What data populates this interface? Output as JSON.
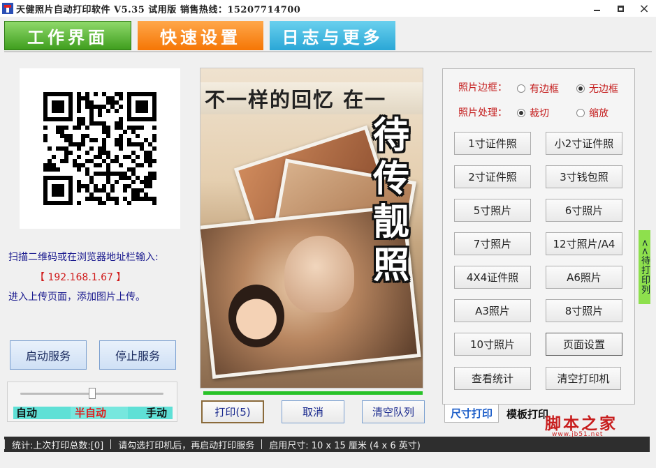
{
  "window": {
    "title": "天健照片自动打印软件  V5.35  试用版 销售热线：15207714700",
    "minimize": "",
    "maximize": "",
    "close": "×"
  },
  "tabs": [
    {
      "label": "工作界面",
      "active": true
    },
    {
      "label": "快速设置",
      "active": false
    },
    {
      "label": "日志与更多",
      "active": false
    }
  ],
  "left": {
    "scan_text": "扫描二维码或在浏览器地址栏输入:",
    "ip": "【 192.168.1.67 】",
    "upload_text": "进入上传页面，添加图片上传。",
    "start_service": "启动服务",
    "stop_service": "停止服务",
    "modes": {
      "auto": "自动",
      "semi_auto": "半自动",
      "manual": "手动",
      "selected": "半自动"
    }
  },
  "preview": {
    "banner": "不一样的回忆  在一",
    "vertical_chars": [
      "待",
      "传",
      "靓",
      "照"
    ]
  },
  "center_buttons": {
    "print": "打印(5)",
    "cancel": "取消",
    "clear_queue": "清空队列"
  },
  "right": {
    "border_label": "照片边框：",
    "border_options": [
      {
        "label": "有边框",
        "checked": false
      },
      {
        "label": "无边框",
        "checked": true
      }
    ],
    "process_label": "照片处理：",
    "process_options": [
      {
        "label": "裁切",
        "checked": true
      },
      {
        "label": "缩放",
        "checked": false
      }
    ],
    "sizes": [
      "1寸证件照",
      "小2寸证件照",
      "2寸证件照",
      "3寸钱包照",
      "5寸照片",
      "6寸照片",
      "7寸照片",
      "12寸照片/A4",
      "4X4证件照",
      "A6照片",
      "A3照片",
      "8寸照片",
      "10寸照片",
      "页面设置"
    ],
    "stats": "查看统计",
    "clear_printer": "清空打印机",
    "bottom_tabs": [
      {
        "label": "尺寸打印",
        "active": true
      },
      {
        "label": "模板打印",
        "active": false
      }
    ]
  },
  "side_tab": {
    "label": "<<待打印列"
  },
  "status": {
    "stats": "统计:上次打印总数:[0]",
    "hint": "请勾选打印机后，再启动打印服务",
    "size": "启用尺寸: 10 x 15 厘米 (4 x 6 英寸)"
  },
  "watermark": {
    "main": "脚本之家",
    "sub": "www.jb51.net"
  },
  "colors": {
    "tab_work": "#4fae2a",
    "tab_quick": "#f57f0f",
    "tab_log": "#34aede",
    "option_text": "#c41b1b",
    "link_text": "#1b1b8f",
    "mode_strip": "#5fe0d6",
    "mode_selected": "#e11b1b",
    "progress": "#28c228"
  }
}
